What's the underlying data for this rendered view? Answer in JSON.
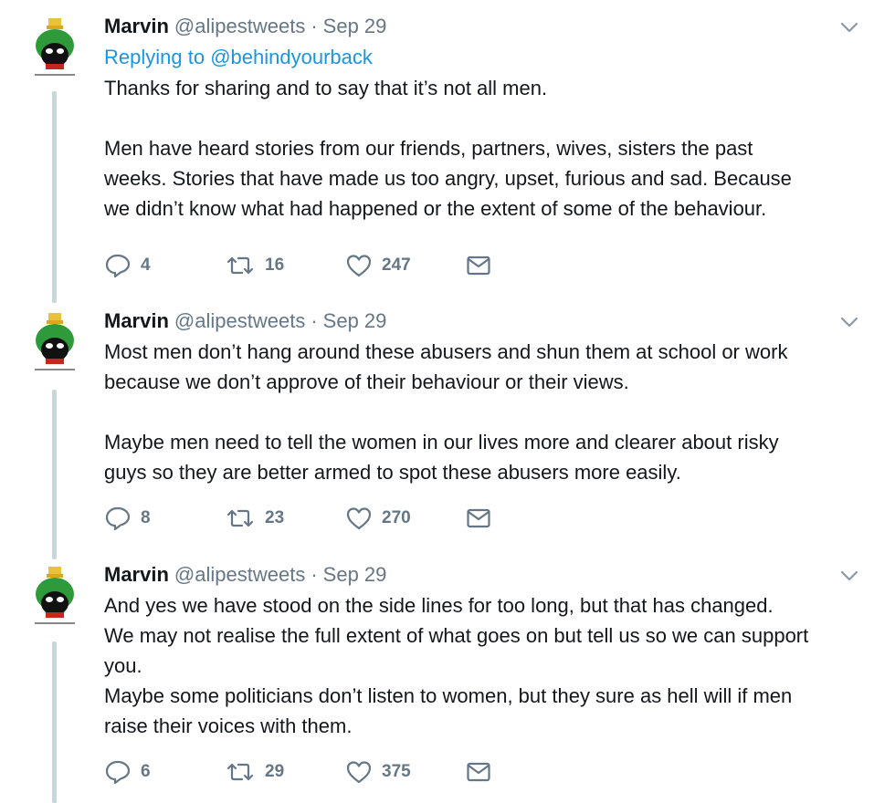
{
  "tweets": [
    {
      "name": "Marvin",
      "handle": "@alipestweets",
      "separator": "·",
      "time": "Sep 29",
      "replying_to_label": "Replying to",
      "replying_to_user": "@behindyourback",
      "paragraphs": [
        "Thanks for sharing and to say that it’s not all men.",
        "Men have heard stories from our friends, partners, wives, sisters the past\nweeks. Stories that have made us too angry, upset, furious and sad. Because\nwe didn’t know what had happened or the extent of some of the behaviour."
      ],
      "replies": "4",
      "retweets": "16",
      "likes": "247"
    },
    {
      "name": "Marvin",
      "handle": "@alipestweets",
      "separator": "·",
      "time": "Sep 29",
      "paragraphs": [
        "Most men don’t hang around these abusers and shun them at school or work\nbecause we don’t approve of their behaviour or their views.",
        "Maybe men need to tell the women in our lives more and clearer about risky\nguys so they are better armed to spot these abusers more easily."
      ],
      "replies": "8",
      "retweets": "23",
      "likes": "270"
    },
    {
      "name": "Marvin",
      "handle": "@alipestweets",
      "separator": "·",
      "time": "Sep 29",
      "paragraphs": [
        "And yes we have stood on the side lines for too long, but that has changed.\nWe may not realise the full extent of what goes on but tell us so we can support\nyou.\nMaybe some politicians don’t listen to women, but they sure as hell will if men\nraise their voices with them."
      ],
      "replies": "6",
      "retweets": "29",
      "likes": "375"
    }
  ],
  "icons": {
    "avatar": "marvin-martian-avatar-icon",
    "caret": "chevron-down-icon",
    "reply": "reply-icon",
    "retweet": "retweet-icon",
    "like": "heart-icon",
    "dm": "envelope-icon"
  },
  "colors": {
    "text": "#14171a",
    "muted": "#657786",
    "link": "#1b95e0",
    "thread_line": "#c4d6de"
  }
}
